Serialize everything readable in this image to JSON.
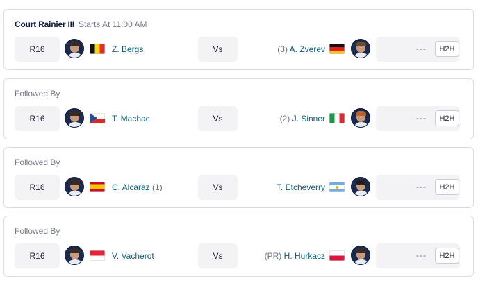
{
  "matches": [
    {
      "header_court": "Court Rainier III",
      "header_text": "Starts At 11:00 AM",
      "round": "R16",
      "vs": "Vs",
      "player1": {
        "name": "Z. Bergs",
        "seed": "",
        "flag": "BEL"
      },
      "player2": {
        "name": "A. Zverev",
        "seed": "(3)",
        "flag": "GER"
      },
      "score": "---",
      "h2h": "H2H"
    },
    {
      "header_court": "",
      "header_text": "Followed By",
      "round": "R16",
      "vs": "Vs",
      "player1": {
        "name": "T. Machac",
        "seed": "",
        "flag": "CZE"
      },
      "player2": {
        "name": "J. Sinner",
        "seed": "(2)",
        "flag": "ITA"
      },
      "score": "---",
      "h2h": "H2H"
    },
    {
      "header_court": "",
      "header_text": "Followed By",
      "round": "R16",
      "vs": "Vs",
      "player1": {
        "name": "C. Alcaraz",
        "seed": "(1)",
        "flag": "ESP"
      },
      "player2": {
        "name": "T. Etcheverry",
        "seed": "",
        "flag": "ARG"
      },
      "score": "---",
      "h2h": "H2H"
    },
    {
      "header_court": "",
      "header_text": "Followed By",
      "round": "R16",
      "vs": "Vs",
      "player1": {
        "name": "V. Vacherot",
        "seed": "",
        "flag": "MON"
      },
      "player2": {
        "name": "H. Hurkacz",
        "seed": "(PR)",
        "flag": "POL"
      },
      "score": "---",
      "h2h": "H2H"
    }
  ],
  "colors": {
    "player_link": "#0b5d7a",
    "court_name": "#0f1d46",
    "muted": "#757a88",
    "pill_bg": "#f3f3f5",
    "border": "#dcdde2"
  }
}
